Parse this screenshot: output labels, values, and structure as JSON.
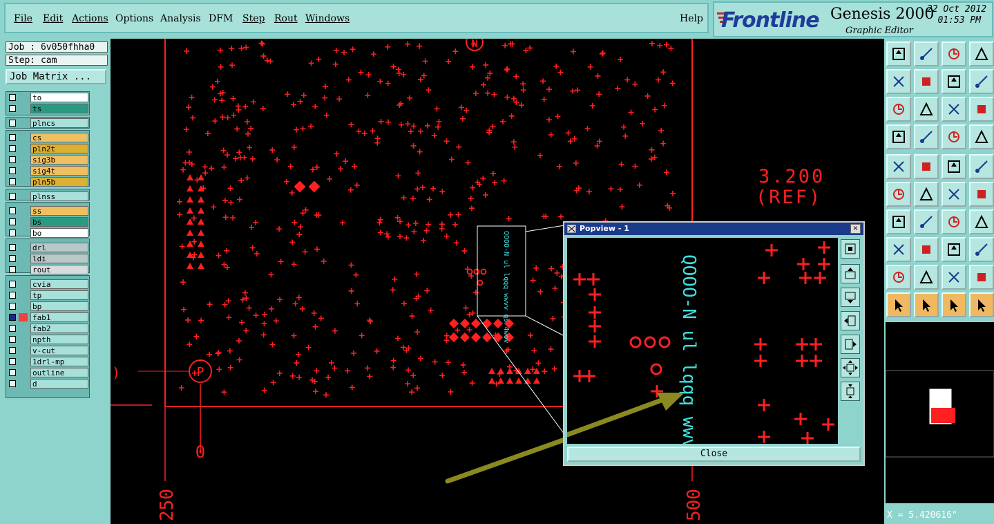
{
  "menu": {
    "items": [
      "File",
      "Edit",
      "Actions",
      "Options",
      "Analysis",
      "DFM",
      "Step",
      "Rout",
      "Windows"
    ],
    "help": "Help"
  },
  "brand": {
    "logo": "Frontline",
    "title": "Genesis 2000",
    "subtitle": "Graphic Editor",
    "date": "22 Oct 2012",
    "time": "01:53 PM"
  },
  "job": {
    "job_label": "Job : 6v050fhha0",
    "step_label": "Step: cam",
    "matrix_button": "Job Matrix ..."
  },
  "layers": [
    {
      "name": "to",
      "color": "#ffffff"
    },
    {
      "name": "ts",
      "color": "#2a9a82"
    },
    {
      "name": "plncs",
      "color": "#a8e0da"
    },
    {
      "name": "cs",
      "color": "#f0c060"
    },
    {
      "name": "pln2t",
      "color": "#dcb030"
    },
    {
      "name": "sig3b",
      "color": "#f0c060"
    },
    {
      "name": "sig4t",
      "color": "#f0c060"
    },
    {
      "name": "pln5b",
      "color": "#dcb030"
    },
    {
      "name": "plnss",
      "color": "#a8e0da"
    },
    {
      "name": "ss",
      "color": "#f0c060"
    },
    {
      "name": "bs",
      "color": "#2a9a82"
    },
    {
      "name": "bo",
      "color": "#ffffff"
    },
    {
      "name": "drl",
      "color": "#b8c8c8"
    },
    {
      "name": "ldi",
      "color": "#b8c8c8"
    },
    {
      "name": "rout",
      "color": "#d8dcdc"
    },
    {
      "name": "cvia",
      "color": "#a8e0da"
    },
    {
      "name": "tp",
      "color": "#a8e0da"
    },
    {
      "name": "bp",
      "color": "#a8e0da"
    },
    {
      "name": "fab1",
      "color": "#a8e0da"
    },
    {
      "name": "fab2",
      "color": "#a8e0da"
    },
    {
      "name": "npth",
      "color": "#a8e0da"
    },
    {
      "name": "v-cut",
      "color": "#a8e0da"
    },
    {
      "name": "1drl-mp",
      "color": "#a8e0da"
    },
    {
      "name": "outline",
      "color": "#a8e0da"
    },
    {
      "name": "d",
      "color": "#a8e0da"
    }
  ],
  "canvas": {
    "dim_value": "3.200",
    "dim_ref": "(REF)",
    "marker_n": "N",
    "marker_p": "P",
    "axis_0": "0",
    "axis_250": "250",
    "axis_500": "500",
    "silk_text": "QOOO-N ul lqqq wwvv qs 4wov",
    "pad_color": "#ff2020",
    "text_color": "#40e0e0",
    "arrow_color": "#8a8a20"
  },
  "popview": {
    "title": "Popview - 1",
    "close_button": "Close",
    "close_icon": "×"
  },
  "status": {
    "x_coord": "X = 5.420616\""
  }
}
